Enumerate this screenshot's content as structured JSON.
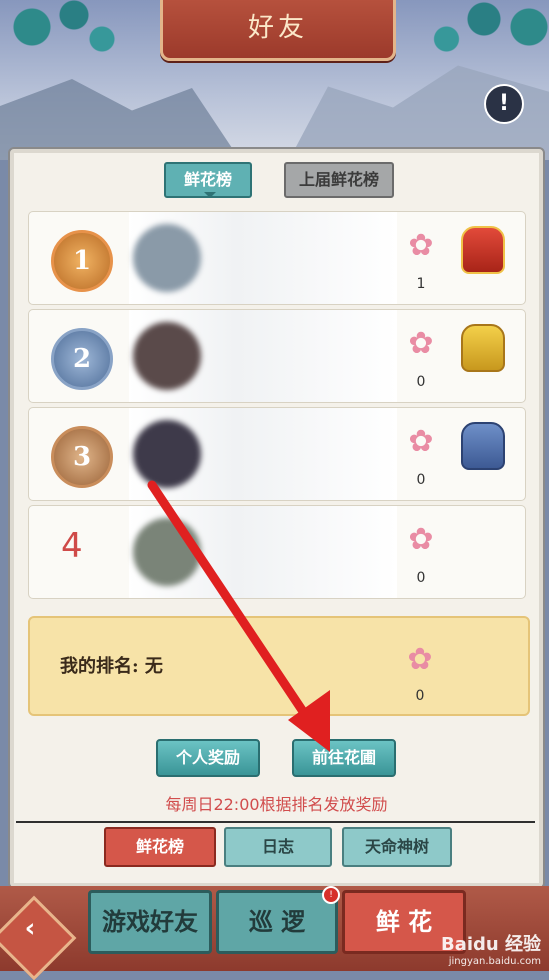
{
  "header": {
    "title": "好友",
    "alert_icon": "exclamation-icon"
  },
  "top_tabs": {
    "active": "鲜花榜",
    "inactive": "上届鲜花榜"
  },
  "ranking": {
    "rows": [
      {
        "rank": "1",
        "rank_type": "gold-medal",
        "flower_count": "1",
        "bag": "red-bag"
      },
      {
        "rank": "2",
        "rank_type": "silver-medal",
        "flower_count": "0",
        "bag": "yellow-bag"
      },
      {
        "rank": "3",
        "rank_type": "bronze-medal",
        "flower_count": "0",
        "bag": "blue-bag"
      },
      {
        "rank": "4",
        "rank_type": "number",
        "flower_count": "0",
        "bag": ""
      }
    ]
  },
  "my_rank": {
    "label": "我的排名: 无",
    "flower_count": "0"
  },
  "buttons": {
    "personal_reward": "个人奖励",
    "go_garden": "前往花圃"
  },
  "notice": "每周日22:00根据排名发放奖励",
  "bottom_tabs": {
    "tab1": "鲜花榜",
    "tab2": "日志",
    "tab3": "天命神树"
  },
  "bottom_nav": {
    "friends": "游戏好友",
    "patrol": "巡 逻",
    "flower": "鲜 花",
    "badge": "!"
  },
  "watermark": {
    "brand": "Baidu 经验",
    "url": "jingyan.baidu.com"
  },
  "colors": {
    "accent_red": "#d5574a",
    "teal": "#5fb1b3",
    "arrow": "#e02020"
  }
}
